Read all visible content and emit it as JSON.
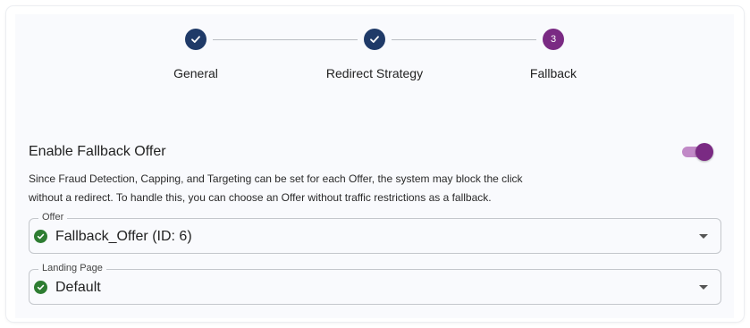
{
  "stepper": {
    "steps": [
      {
        "label": "General",
        "status": "complete",
        "icon": "check-icon"
      },
      {
        "label": "Redirect Strategy",
        "status": "complete",
        "icon": "check-icon"
      },
      {
        "label": "Fallback",
        "status": "active",
        "number": "3"
      }
    ]
  },
  "fallback": {
    "title": "Enable Fallback Offer",
    "enabled": true,
    "description_line1": "Since Fraud Detection, Capping, and Targeting can be set for each Offer, the system may block the click",
    "description_line2": "without a redirect. To handle this, you can choose an Offer without traffic restrictions as a fallback."
  },
  "offer_field": {
    "label": "Offer",
    "value": "Fallback_Offer (ID: 6)",
    "status_icon": "check-circle-icon"
  },
  "landing_field": {
    "label": "Landing Page",
    "value": "Default",
    "status_icon": "check-circle-icon"
  },
  "colors": {
    "step_complete": "#1f3a68",
    "step_active": "#7a2a83",
    "toggle_track": "#c189c7",
    "toggle_thumb": "#7a2a83",
    "check_green": "#2e7d32",
    "panel_bg": "#f9fafd"
  }
}
